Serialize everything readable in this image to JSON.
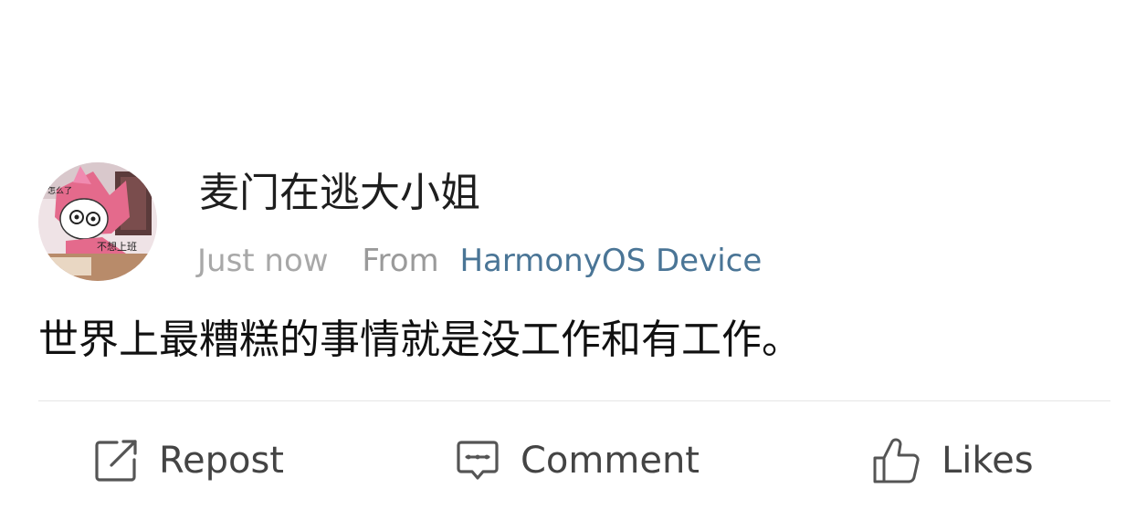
{
  "post": {
    "username": "麦门在逃大小姐",
    "time": "Just now",
    "from_label": "From",
    "device": "HarmonyOS Device",
    "content": "世界上最糟糕的事情就是没工作和有工作。",
    "avatar_caption": "不想上班",
    "colors": {
      "link": "#4a7596",
      "muted": "#a8a8a8",
      "text": "#1a1a1a"
    }
  },
  "actions": {
    "repost": {
      "label": "Repost",
      "icon": "share-edit-icon"
    },
    "comment": {
      "label": "Comment",
      "icon": "comment-icon"
    },
    "likes": {
      "label": "Likes",
      "icon": "thumbs-up-icon"
    }
  }
}
